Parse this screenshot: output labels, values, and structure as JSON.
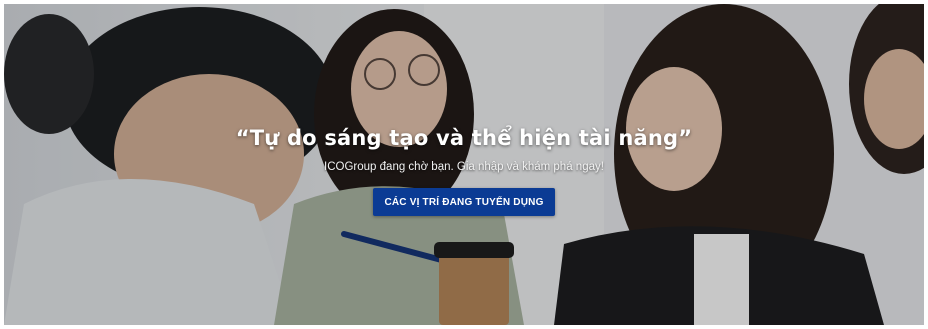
{
  "hero": {
    "title": "“Tự do sáng tạo và thể hiện tài năng”",
    "subtitle": "ICOGroup đang chờ bạn. Gia nhập và khám phá ngay!",
    "cta_label": "CÁC VỊ TRÍ ĐANG TUYỂN DỤNG",
    "accent_color": "#0b3b94"
  }
}
